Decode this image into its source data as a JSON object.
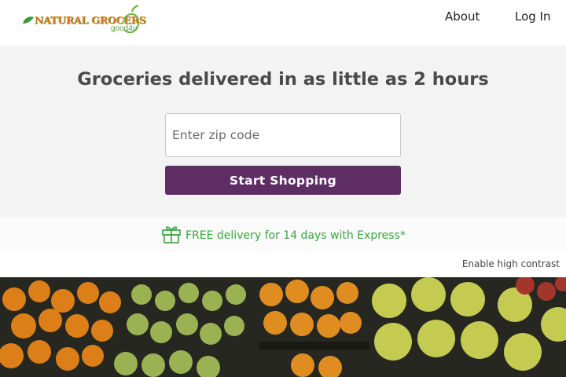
{
  "header": {
    "logo_text": "Natural Grocers",
    "logo_subtext": "good4u",
    "nav": [
      {
        "label": "About"
      },
      {
        "label": "Log In"
      }
    ]
  },
  "hero": {
    "headline": "Groceries delivered in as little as 2 hours",
    "zip_placeholder": "Enter zip code",
    "cta_label": "Start Shopping"
  },
  "promo": {
    "icon": "gift-icon",
    "text": "FREE delivery for 14 days with Express*"
  },
  "accessibility": {
    "contrast_label": "Enable high contrast"
  },
  "colors": {
    "cta": "#5d2d63",
    "promo_text": "#3aa43e",
    "hero_bg": "#f3f3f3"
  }
}
